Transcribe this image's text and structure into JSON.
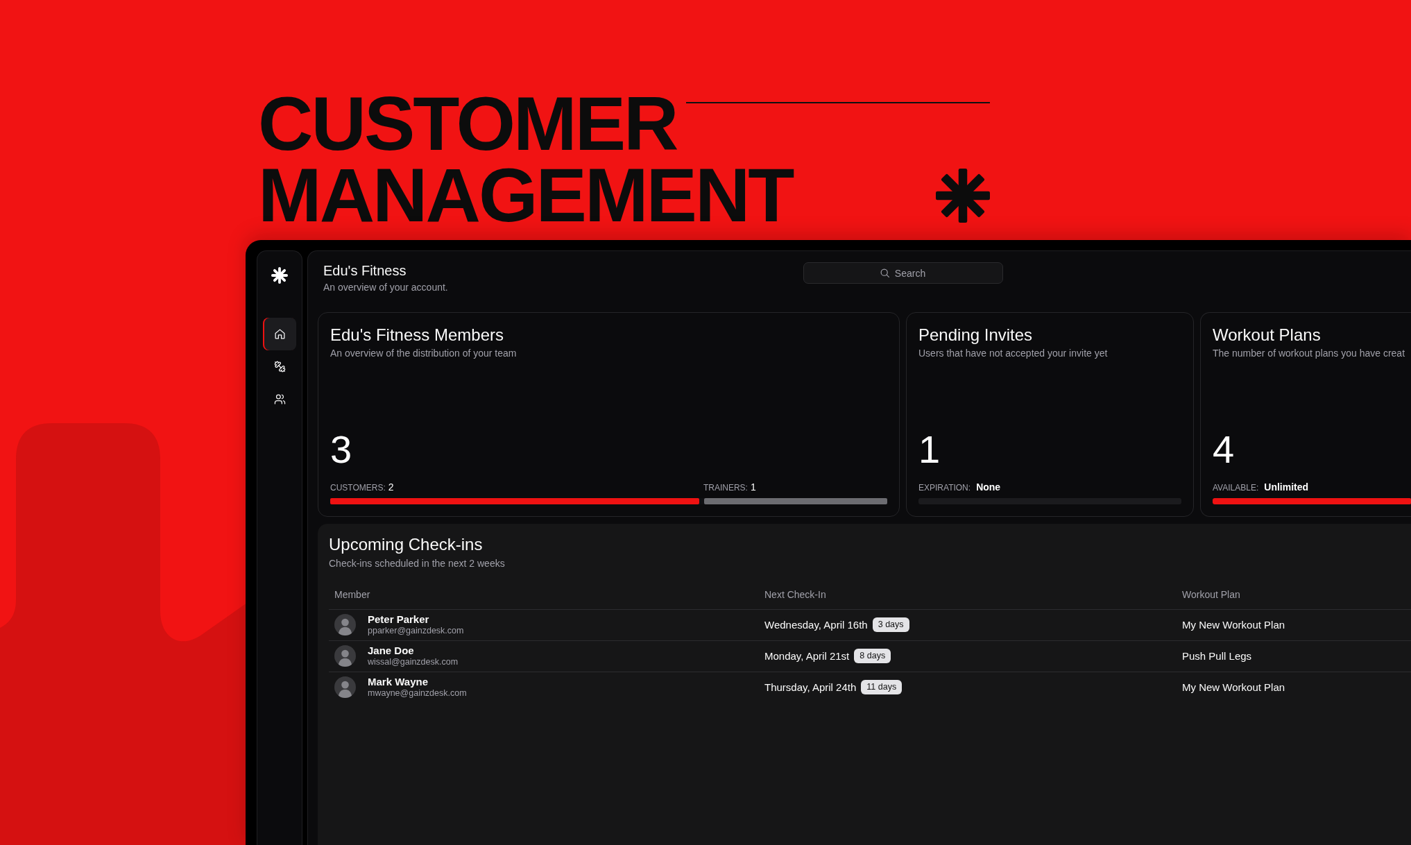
{
  "hero": {
    "title_lines": [
      "CUSTOMER",
      "MANAGEMENT"
    ]
  },
  "sidebar": {
    "items": [
      {
        "selected": true
      },
      {
        "selected": false
      },
      {
        "selected": false
      }
    ]
  },
  "header": {
    "title": "Edu's Fitness",
    "subtitle": "An overview of your account.",
    "search": {
      "placeholder": "Search"
    }
  },
  "cards": [
    {
      "kind": "split",
      "title": "Edu's Fitness Members",
      "subtitle": "An overview of the distribution of your team",
      "value": "3",
      "segments": [
        {
          "label": "CUSTOMERS:",
          "value": "2",
          "level": 0.667,
          "color": "#ef1212"
        },
        {
          "label": "TRAINERS:",
          "value": "1",
          "level": 0.333,
          "color": "#6c6c71"
        }
      ]
    },
    {
      "kind": "single",
      "title": "Pending Invites",
      "subtitle": "Users that have not accepted your invite yet",
      "value": "1",
      "label": "EXPIRATION:",
      "detail": "None"
    },
    {
      "kind": "single",
      "title": "Workout Plans",
      "subtitle": "The number of workout plans you have creat",
      "value": "4",
      "label": "AVAILABLE:",
      "detail": "Unlimited",
      "level": 1
    }
  ],
  "checkins": {
    "title": "Upcoming Check-ins",
    "subtitle": "Check-ins scheduled in the next 2 weeks",
    "columns": [
      "Member",
      "Next Check-In",
      "Workout Plan"
    ],
    "rows": [
      {
        "name": "Peter Parker",
        "email": "pparker@gainzdesk.com",
        "date": "Wednesday, April 16th",
        "badge": "3 days",
        "plan": "My New Workout Plan"
      },
      {
        "name": "Jane Doe",
        "email": "wissal@gainzdesk.com",
        "date": "Monday, April 21st",
        "badge": "8 days",
        "plan": "Push Pull Legs"
      },
      {
        "name": "Mark Wayne",
        "email": "mwayne@gainzdesk.com",
        "date": "Thursday, April 24th",
        "badge": "11 days",
        "plan": "My New Workout Plan"
      }
    ]
  }
}
